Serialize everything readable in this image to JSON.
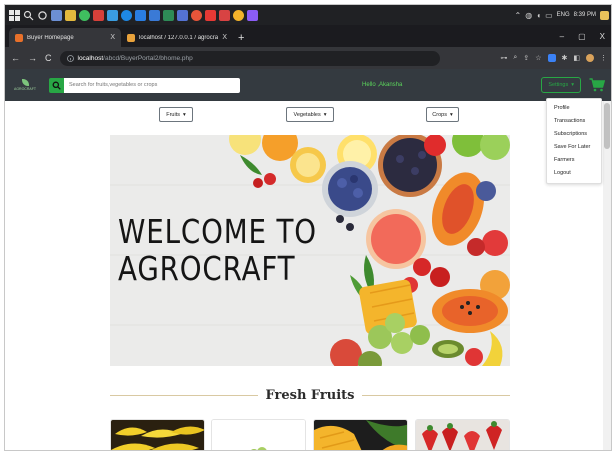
{
  "browser": {
    "tabs": [
      {
        "label": "Buyer Homepage",
        "close": "X",
        "active": true,
        "favicon_color": "#e8702a"
      },
      {
        "label": "localhost / 127.0.0.1 / agrocraft",
        "close": "X",
        "active": false,
        "favicon_color": "#e9a23b"
      }
    ],
    "new_tab": "+",
    "window_controls": {
      "minimize": "–",
      "maximize": "▢",
      "close": "X"
    },
    "url_host": "localhost",
    "url_path": "/abcd/BuyerPortal2/bhome.php"
  },
  "taskbar": {
    "language": "ENG",
    "time": "8:39 PM"
  },
  "navbar": {
    "brand_text": "AGROCRAFT",
    "search_placeholder": "Search for fruits,vegetables or crops",
    "greeting": "Hello ,Akansha",
    "settings_label": "Settings",
    "accent_color": "#28a745"
  },
  "settings_menu": {
    "items": [
      "Profile",
      "Transactions",
      "Subscriptions",
      "Save For Later",
      "Farmers",
      "Logout"
    ]
  },
  "categories": [
    {
      "label": "Fruits"
    },
    {
      "label": "Vegetables"
    },
    {
      "label": "Crops"
    }
  ],
  "hero": {
    "line1": "WELCOME TO",
    "line2": "AGROCRAFT"
  },
  "section": {
    "title": "Fresh Fruits"
  }
}
